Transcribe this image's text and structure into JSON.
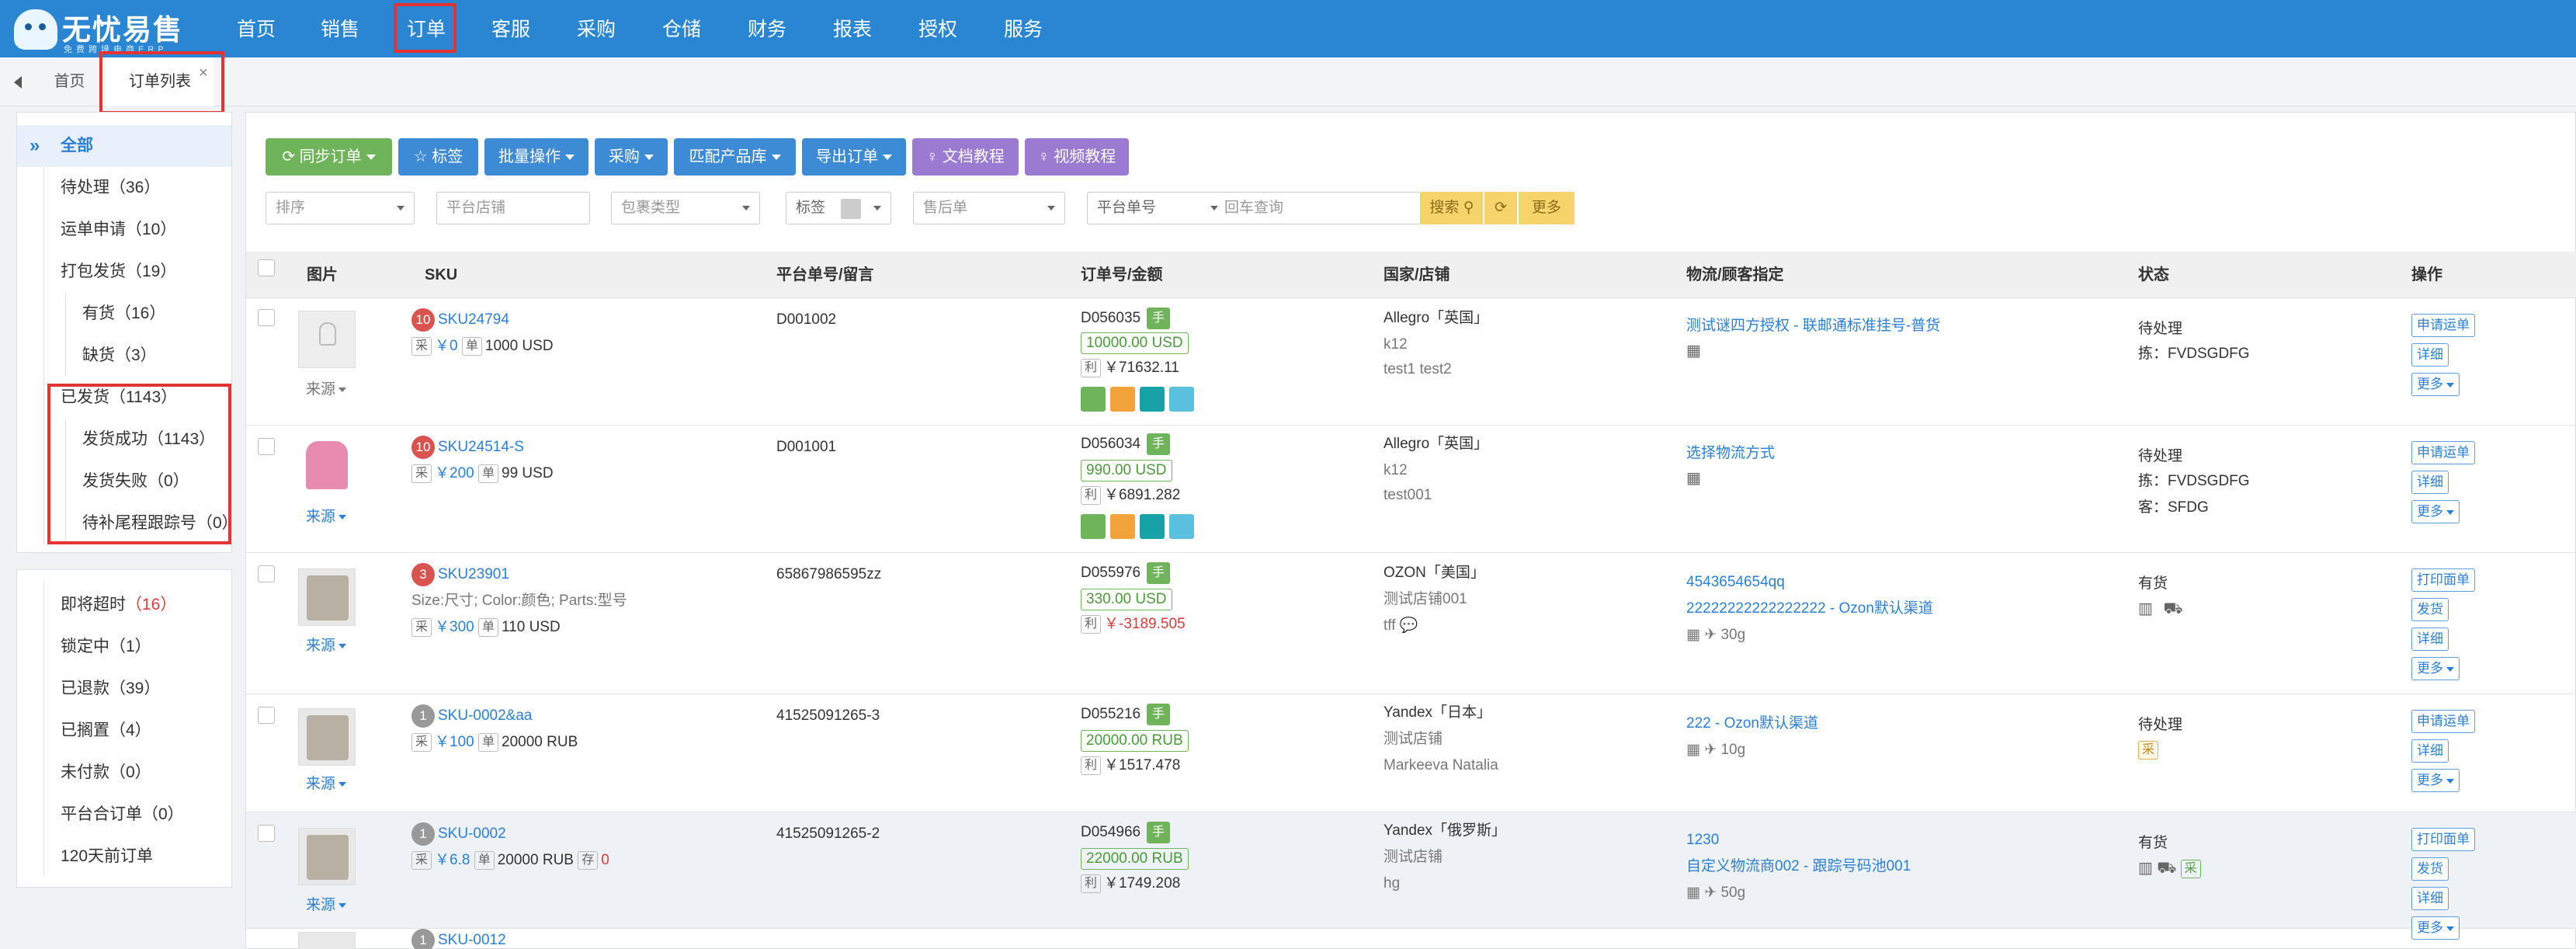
{
  "brand": {
    "name": "无忧易售",
    "subtitle": "免费跨境电商ERP"
  },
  "nav": [
    "首页",
    "销售",
    "订单",
    "客服",
    "采购",
    "仓储",
    "财务",
    "报表",
    "授权",
    "服务"
  ],
  "tabs": {
    "home": "首页",
    "active": "订单列表",
    "close": "×"
  },
  "sidebar": {
    "items": [
      {
        "label": "全部"
      },
      {
        "label": "待处理（36）"
      },
      {
        "label": "运单申请（10）"
      },
      {
        "label": "打包发货（19）"
      },
      {
        "label": "有货（16）"
      },
      {
        "label": "缺货（3）"
      },
      {
        "label": "已发货（1143）"
      },
      {
        "label": "发货成功（1143）"
      },
      {
        "label": "发货失败（0）"
      },
      {
        "label": "待补尾程跟踪号（0）"
      }
    ],
    "items2": [
      {
        "label": "即将超时",
        "count": "（16）"
      },
      {
        "label": "锁定中（1）"
      },
      {
        "label": "已退款（39）"
      },
      {
        "label": "已搁置（4）"
      },
      {
        "label": "未付款（0）"
      },
      {
        "label": "平台合订单（0）"
      },
      {
        "label": "120天前订单"
      }
    ]
  },
  "toolbar": {
    "sync": "同步订单",
    "tag": "标签",
    "batch": "批量操作",
    "purchase": "采购",
    "match": "匹配产品库",
    "export": "导出订单",
    "doc": "文档教程",
    "video": "视频教程"
  },
  "filters": {
    "sort": "排序",
    "store": "平台店铺",
    "package": "包裹类型",
    "tag": "标签",
    "aftersale": "售后单",
    "order_no": "平台单号",
    "search_placeholder": "回车查询",
    "search": "搜索",
    "more": "更多"
  },
  "columns": [
    "图片",
    "SKU",
    "平台单号/留言",
    "订单号/金额",
    "国家/店铺",
    "物流/顾客指定",
    "状态",
    "操作"
  ],
  "src_label": "来源",
  "rows": [
    {
      "badge": "10",
      "sku": "SKU24794",
      "price": "￥0",
      "qty": "1000 USD",
      "platform_no": "D001002",
      "order_no": "D056035",
      "amount": "10000.00 USD",
      "profit": "￥71632.11",
      "country": "Allegro「英国」",
      "store": "k12",
      "extra": "test1 test2",
      "logistics": "测试谜四方授权 - 联邮通标准挂号-普货",
      "status": "待处理",
      "status2": "拣：FVDSGDFG",
      "ops": [
        "申请运单",
        "详细",
        "更多"
      ]
    },
    {
      "badge": "10",
      "sku": "SKU24514-S",
      "price": "￥200",
      "qty": "99 USD",
      "platform_no": "D001001",
      "order_no": "D056034",
      "amount": "990.00 USD",
      "profit": "￥6891.282",
      "country": "Allegro「英国」",
      "store": "k12",
      "extra": "test001",
      "logistics": "选择物流方式",
      "status": "待处理",
      "status2": "拣：FVDSGDFG",
      "status3": "客：SFDG",
      "ops": [
        "申请运单",
        "详细",
        "更多"
      ]
    },
    {
      "badge": "3",
      "sku": "SKU23901",
      "attrs": "Size:尺寸; Color:颜色; Parts:型号",
      "price": "￥300",
      "qty": "110 USD",
      "platform_no": "65867986595zz",
      "order_no": "D055976",
      "amount": "330.00 USD",
      "profit": "￥-3189.505",
      "country": "OZON「美国」",
      "store": "测试店铺001",
      "extra": "tff",
      "logistics": "4543654654qq",
      "logistics2": "22222222222222222 - Ozon默认渠道",
      "weight": "30g",
      "status": "有货",
      "ops": [
        "打印面单",
        "发货",
        "详细",
        "更多"
      ]
    },
    {
      "badge": "1",
      "sku": "SKU-0002&aa",
      "price": "￥100",
      "qty": "20000 RUB",
      "platform_no": "41525091265-3",
      "order_no": "D055216",
      "amount": "20000.00 RUB",
      "profit": "￥1517.478",
      "country": "Yandex「日本」",
      "store": "测试店铺",
      "extra": "Markeeva Natalia",
      "logistics": "222 - Ozon默认渠道",
      "weight": "10g",
      "status": "待处理",
      "status_tag": "采",
      "ops": [
        "申请运单",
        "详细",
        "更多"
      ]
    },
    {
      "badge": "1",
      "sku": "SKU-0002",
      "price": "￥6.8",
      "qty": "20000 RUB",
      "stock": "0",
      "platform_no": "41525091265-2",
      "order_no": "D054966",
      "amount": "22000.00 RUB",
      "profit": "￥1749.208",
      "country": "Yandex「俄罗斯」",
      "store": "测试店铺",
      "extra": "hg",
      "logistics": "1230",
      "logistics2": "自定义物流商002 - 跟踪号码池001",
      "weight": "50g",
      "status": "有货",
      "status_tag": "采",
      "ops": [
        "打印面单",
        "发货",
        "详细",
        "更多"
      ]
    },
    {
      "badge": "1",
      "sku": "SKU-0012"
    }
  ],
  "labels": {
    "cai": "采",
    "dan": "单",
    "li": "利",
    "shou": "手",
    "cun": "存"
  },
  "colors": {
    "nav": "#2a86d3",
    "highlight": "#e53333",
    "link": "#2a7fd6",
    "swatches": [
      "#6fb35b",
      "#f2a33a",
      "#17a2a8",
      "#5bc0de"
    ]
  }
}
